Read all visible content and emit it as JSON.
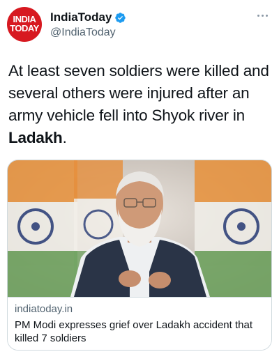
{
  "account": {
    "avatar_line1": "INDIA",
    "avatar_line2": "TODAY",
    "display_name": "IndiaToday",
    "handle": "@IndiaToday",
    "verified": true
  },
  "tweet": {
    "text_before": "At least seven soldiers were killed and several others were injured after an army vehicle fell into Shyok river in ",
    "text_bold": "Ladakh",
    "text_after": "."
  },
  "card": {
    "domain": "indiatoday.in",
    "title": "PM Modi expresses grief over Ladakh accident that killed 7 soldiers"
  },
  "icons": {
    "verified": "verified-badge-icon",
    "more": "more-options-icon"
  },
  "colors": {
    "brand_red": "#d71920",
    "verified_blue": "#1d9bf0",
    "secondary_text": "#536471",
    "border": "#cfd9de"
  }
}
